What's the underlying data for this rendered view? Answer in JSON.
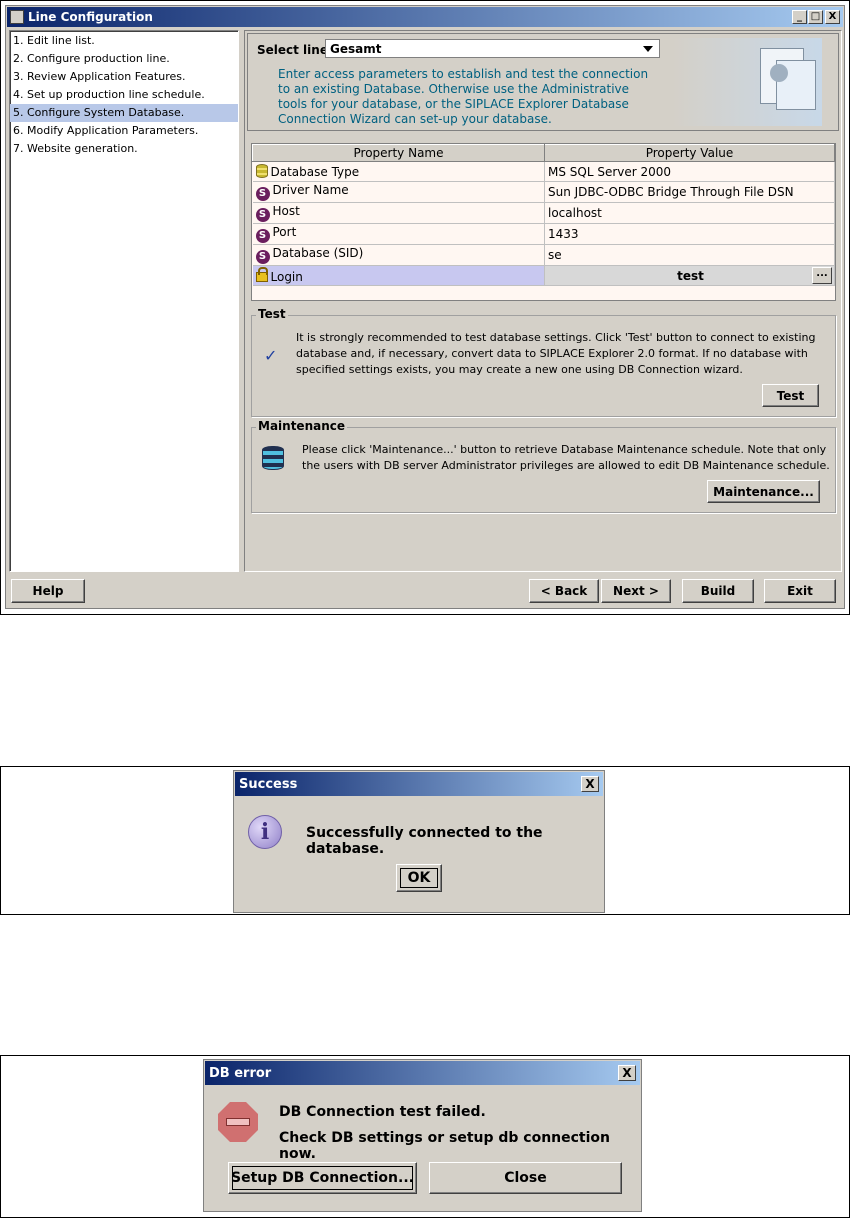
{
  "main_window": {
    "title": "Line Configuration",
    "title_buttons": [
      "_",
      "□",
      "X"
    ],
    "steps": [
      "1. Edit line list.",
      "2. Configure production line.",
      "3. Review Application Features.",
      "4. Set up production line schedule.",
      "5. Configure System Database.",
      "6. Modify Application Parameters.",
      "7. Website generation."
    ],
    "selected_step_index": 4,
    "select_line": {
      "label": "Select line:",
      "value": "Gesamt"
    },
    "intro_text": "Enter access parameters to establish and test the connection to an existing Database. Otherwise use the Administrative tools for your database, or the SIPLACE Explorer Database Connection Wizard can set-up your database.",
    "table": {
      "headers": [
        "Property Name",
        "Property Value"
      ],
      "rows": [
        {
          "icon": "database-icon",
          "name": "Database Type",
          "value": "MS SQL Server 2000"
        },
        {
          "icon": "string-icon",
          "icon_glyph": "S",
          "name": "Driver Name",
          "value": "Sun JDBC-ODBC Bridge Through File DSN"
        },
        {
          "icon": "string-icon",
          "icon_glyph": "S",
          "name": "Host",
          "value": "localhost"
        },
        {
          "icon": "string-icon",
          "icon_glyph": "S",
          "name": "Port",
          "value": "1433"
        },
        {
          "icon": "string-icon",
          "icon_glyph": "S",
          "name": "Database (SID)",
          "value": "se"
        },
        {
          "icon": "lock-icon",
          "name": "Login",
          "value": "test",
          "button": "..."
        }
      ]
    },
    "test_group": {
      "label": "Test",
      "text": "It is strongly recommended to test database settings. Click 'Test' button to connect to existing database and, if necessary, convert data to SIPLACE Explorer 2.0 format. If no database with specified settings exists, you may create a new one using DB Connection wizard.",
      "button": "Test"
    },
    "maintenance_group": {
      "label": "Maintenance",
      "text": "Please click 'Maintenance...' button to retrieve Database Maintenance schedule. Note that only the users with DB server Administrator privileges are allowed to edit DB Maintenance schedule.",
      "button": "Maintenance..."
    },
    "footer": {
      "help": "Help",
      "back": "< Back",
      "next": "Next >",
      "build": "Build",
      "exit": "Exit"
    }
  },
  "success_dialog": {
    "title": "Success",
    "close": "X",
    "icon": "info-icon",
    "icon_glyph": "i",
    "message": "Successfully connected to the database.",
    "ok": "OK"
  },
  "error_dialog": {
    "title": "DB error",
    "close": "X",
    "icon": "error-stop-icon",
    "message_line1": "DB Connection test failed.",
    "message_line2": "Check DB settings or setup db connection now.",
    "setup_button": "Setup DB Connection...",
    "close_button": "Close"
  },
  "colors": {
    "title_gradient_start": "#0a246a",
    "title_gradient_end": "#a6caf0",
    "window_bg": "#d4d0c8",
    "selected_step": "#b8c8e8",
    "row_bg": "#fff7f2",
    "intro_text": "#006080"
  }
}
